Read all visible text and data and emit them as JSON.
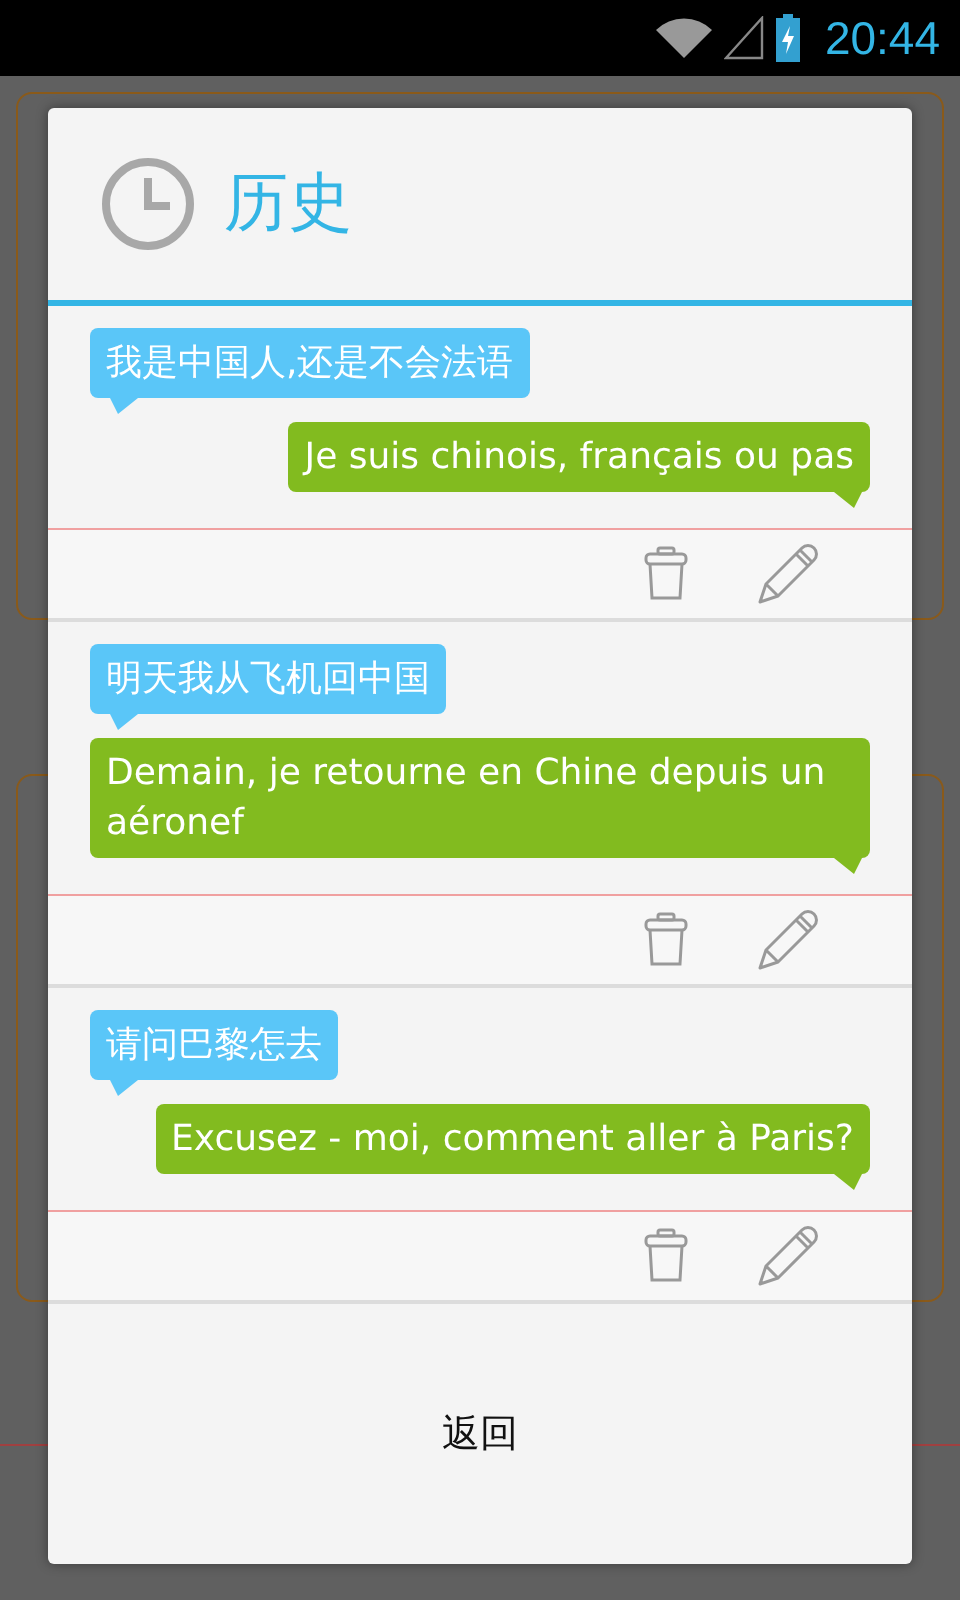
{
  "status_bar": {
    "time": "20:44"
  },
  "dialog": {
    "title": "历史",
    "entries": [
      {
        "source": "我是中国人,还是不会法语",
        "translation": "Je suis chinois, français ou pas"
      },
      {
        "source": "明天我从飞机回中国",
        "translation": "Demain, je retourne en Chine depuis un aéronef"
      },
      {
        "source": "请问巴黎怎去",
        "translation": "Excusez - moi, comment aller à Paris?"
      }
    ],
    "button": "返回"
  }
}
